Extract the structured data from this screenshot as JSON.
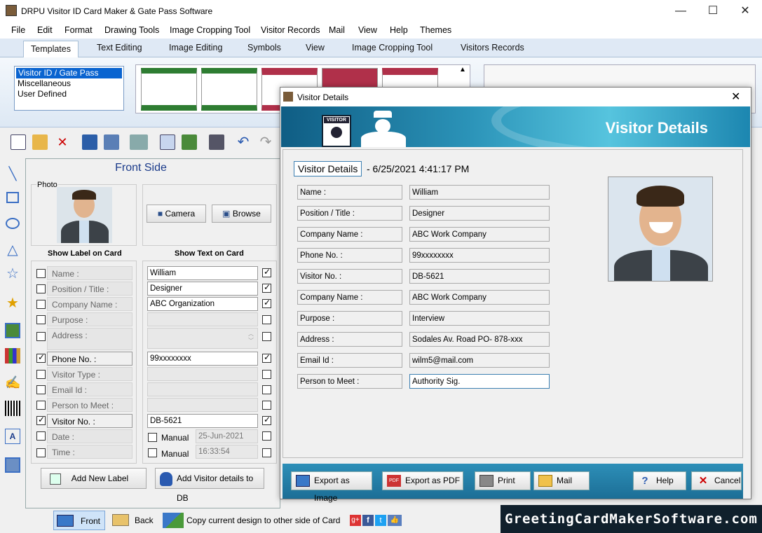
{
  "app": {
    "title": "DRPU Visitor ID Card Maker & Gate Pass Software"
  },
  "menu": [
    "File",
    "Edit",
    "Format",
    "Drawing Tools",
    "Image Cropping Tool",
    "Visitor Records",
    "Mail",
    "View",
    "Help",
    "Themes"
  ],
  "ribbon_tabs": [
    "Templates",
    "Text Editing",
    "Image Editing",
    "Symbols",
    "View",
    "Image Cropping Tool",
    "Visitors Records"
  ],
  "template_categories": [
    "Visitor ID / Gate Pass",
    "Miscellaneous",
    "User Defined"
  ],
  "front": {
    "title": "Front Side",
    "photo_label": "Photo",
    "camera": "Camera",
    "browse": "Browse",
    "show_label": "Show Label on Card",
    "show_text": "Show Text on Card",
    "rows": [
      {
        "label": "Name :",
        "value": "William"
      },
      {
        "label": "Position / Title :",
        "value": "Designer"
      },
      {
        "label": "Company Name :",
        "value": "ABC Organization"
      },
      {
        "label": "Purpose :",
        "value": ""
      },
      {
        "label": "Address :",
        "value": ""
      },
      {
        "label": "Phone No. :",
        "value": "99xxxxxxxx"
      },
      {
        "label": "Visitor Type :",
        "value": ""
      },
      {
        "label": "Email Id :",
        "value": ""
      },
      {
        "label": "Person to Meet :",
        "value": ""
      },
      {
        "label": "Visitor No. :",
        "value": "DB-5621"
      },
      {
        "label": "Date :",
        "value": "25-Jun-2021",
        "manual": "Manual"
      },
      {
        "label": "Time :",
        "value": "16:33:54",
        "manual": "Manual"
      }
    ],
    "add_label": "Add New Label",
    "add_db": "Add Visitor details to DB"
  },
  "status": {
    "front": "Front",
    "back": "Back",
    "copy": "Copy current design to other side of Card"
  },
  "brand": "GreetingCardMakerSoftware.com",
  "dialog": {
    "title": "Visitor Details",
    "banner_title": "Visitor Details",
    "banner_badge": "VISITOR",
    "heading_box": "Visitor Details",
    "timestamp": "- 6/25/2021 4:41:17 PM",
    "fields": [
      {
        "label": "Name :",
        "value": "William"
      },
      {
        "label": "Position / Title :",
        "value": "Designer"
      },
      {
        "label": "Company Name :",
        "value": "ABC Work Company"
      },
      {
        "label": "Phone No. :",
        "value": "99xxxxxxxx"
      },
      {
        "label": "Visitor No. :",
        "value": "DB-5621"
      },
      {
        "label": "Company Name :",
        "value": "ABC Work Company"
      },
      {
        "label": "Purpose :",
        "value": "Interview"
      },
      {
        "label": "Address :",
        "value": "Sodales Av. Road  PO- 878-xxx"
      },
      {
        "label": "Email Id :",
        "value": "wilm5@mail.com"
      },
      {
        "label": "Person to Meet :",
        "value": "Authority Sig."
      }
    ],
    "buttons": {
      "export_image": "Export as Image",
      "export_pdf": "Export as PDF",
      "print": "Print",
      "mail": "Mail",
      "help": "Help",
      "cancel": "Cancel"
    }
  }
}
